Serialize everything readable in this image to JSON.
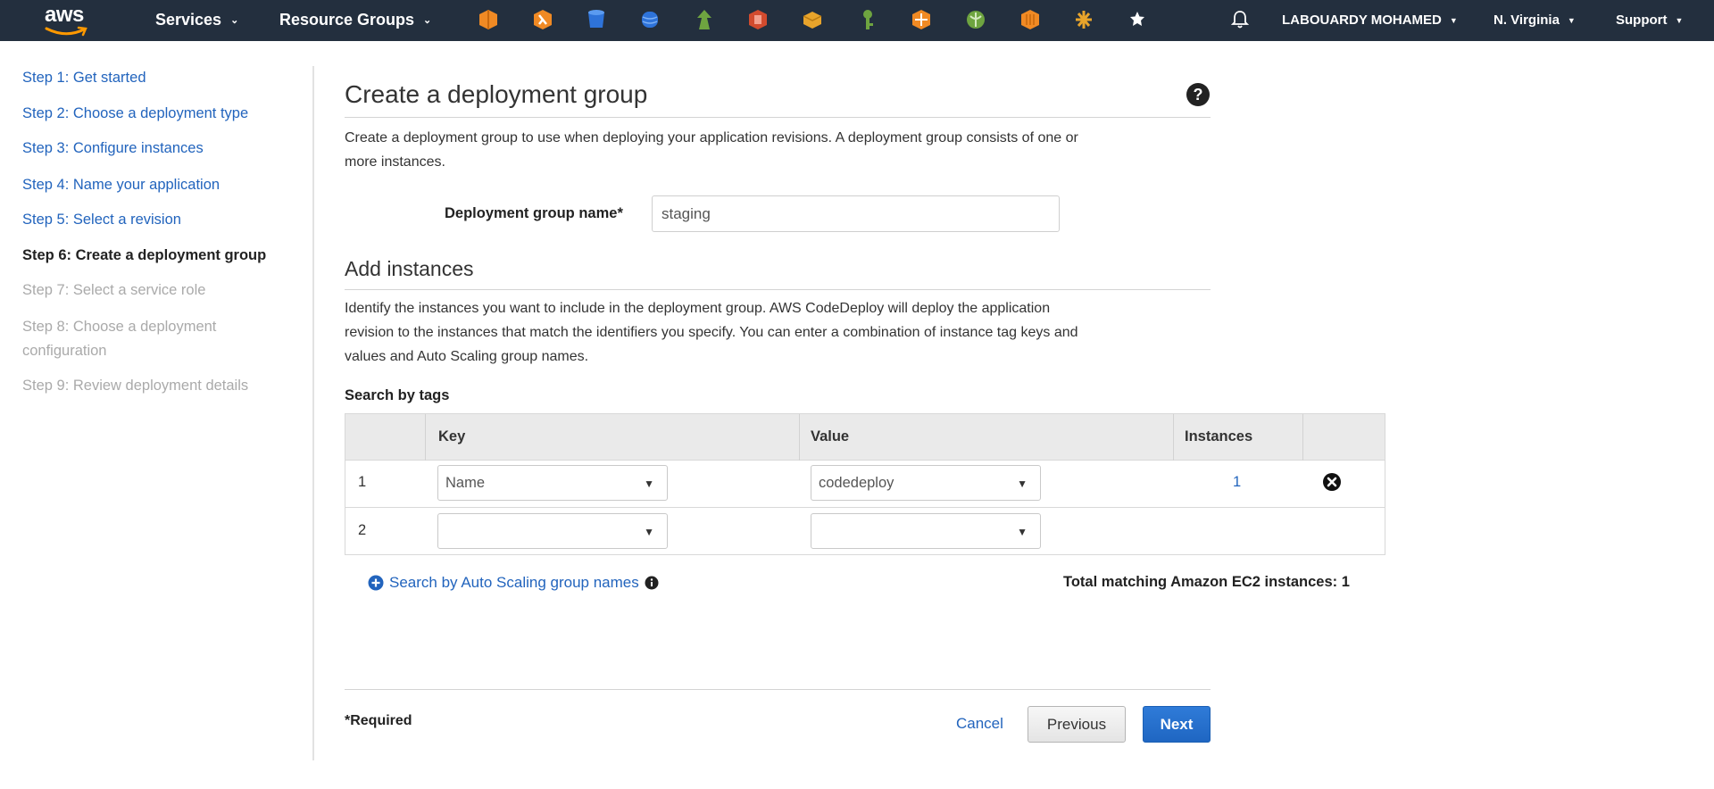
{
  "topbar": {
    "logo_text": "aws",
    "services_label": "Services",
    "resource_groups_label": "Resource Groups",
    "service_icons": [
      {
        "name": "ec2-icon",
        "color": "#f08a24"
      },
      {
        "name": "lambda-icon",
        "color": "#f08a24"
      },
      {
        "name": "s3-icon",
        "color": "#2e73d9"
      },
      {
        "name": "rds-icon",
        "color": "#2e73d9"
      },
      {
        "name": "cloudwatch-icon",
        "color": "#6ea440"
      },
      {
        "name": "codedeploy-icon",
        "color": "#d24b2e"
      },
      {
        "name": "cloudformation-icon",
        "color": "#e8a42b"
      },
      {
        "name": "iam-icon",
        "color": "#6ea440"
      },
      {
        "name": "api-gateway-icon",
        "color": "#f08a24"
      },
      {
        "name": "elastic-beanstalk-icon",
        "color": "#6ea440"
      },
      {
        "name": "ecs-icon",
        "color": "#f08a24"
      },
      {
        "name": "sns-icon",
        "color": "#e8a42b"
      }
    ],
    "pin_icon": "pin-icon",
    "bell_icon": "bell-icon",
    "user_label": "LABOUARDY MOHAMED",
    "region_label": "N. Virginia",
    "support_label": "Support"
  },
  "sidebar": {
    "steps": [
      {
        "label": "Step 1: Get started",
        "state": "link"
      },
      {
        "label": "Step 2: Choose a deployment type",
        "state": "link"
      },
      {
        "label": "Step 3: Configure instances",
        "state": "link"
      },
      {
        "label": "Step 4: Name your application",
        "state": "link"
      },
      {
        "label": "Step 5: Select a revision",
        "state": "link"
      },
      {
        "label": "Step 6: Create a deployment group",
        "state": "active"
      },
      {
        "label": "Step 7: Select a service role",
        "state": "disabled"
      },
      {
        "label": "Step 8: Choose a deployment",
        "state": "disabled"
      },
      {
        "label": "configuration",
        "state": "disabled"
      },
      {
        "label": "Step 9: Review deployment details",
        "state": "disabled"
      }
    ]
  },
  "main": {
    "title": "Create a deployment group",
    "intro_line1": "Create a deployment group to use when deploying your application revisions. A deployment group consists of one or",
    "intro_line2": "more instances.",
    "group_name_label": "Deployment group name*",
    "group_name_value": "staging",
    "add_instances_title": "Add instances",
    "instances_text_line1": "Identify the instances you want to include in the deployment group. AWS CodeDeploy will deploy the application",
    "instances_text_line2": "revision to the instances that match the identifiers you specify. You can enter a combination of instance tag keys and",
    "instances_text_line3": "values and Auto Scaling group names.",
    "search_by_tags_label": "Search by tags",
    "table": {
      "headers": {
        "key": "Key",
        "value": "Value",
        "instances": "Instances"
      },
      "rows": [
        {
          "num": "1",
          "key": "Name",
          "value": "codedeploy",
          "instances": "1"
        },
        {
          "num": "2",
          "key": "",
          "value": "",
          "instances": ""
        }
      ]
    },
    "asg_link_label": "Search by Auto Scaling group names",
    "total_matching": "Total matching Amazon EC2 instances: 1",
    "required_note": "*Required",
    "cancel_label": "Cancel",
    "previous_label": "Previous",
    "next_label": "Next"
  }
}
